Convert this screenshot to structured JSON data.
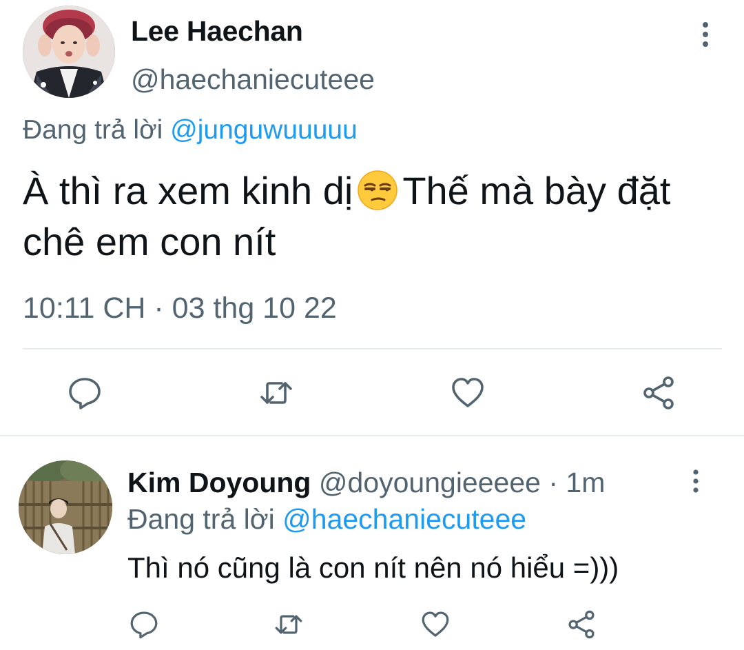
{
  "main_tweet": {
    "display_name": "Lee Haechan",
    "handle": "@haechaniecuteee",
    "replying_prefix": "Đang trả lời ",
    "replying_to": "@junguwuuuuu",
    "text_part1": "À thì ra xem kinh dị",
    "text_emoji": "😒",
    "text_part2": "Thế mà bày đặt chê em con nít",
    "timestamp": "10:11 CH · 03 thg 10 22",
    "actions": [
      {
        "icon": "reply-icon"
      },
      {
        "icon": "retweet-icon"
      },
      {
        "icon": "like-icon"
      },
      {
        "icon": "share-icon"
      }
    ]
  },
  "reply_tweet": {
    "display_name": "Kim Doyoung",
    "handle": "@doyoungieeeee",
    "separator": " · ",
    "time_ago": "1m",
    "replying_prefix": "Đang trả lời ",
    "replying_to": "@haechaniecuteee",
    "text": "Thì nó cũng là con nít nên nó hiểu =)))",
    "actions": [
      {
        "icon": "reply-icon"
      },
      {
        "icon": "retweet-icon"
      },
      {
        "icon": "like-icon"
      },
      {
        "icon": "share-icon"
      }
    ]
  },
  "colors": {
    "text_primary": "#0f1419",
    "text_secondary": "#536471",
    "link": "#1d9bf0",
    "divider": "#e6ecf0",
    "icon": "#536471"
  }
}
